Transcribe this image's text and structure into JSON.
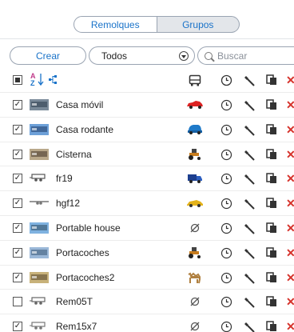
{
  "tabs": {
    "remolques": "Remolques",
    "grupos": "Grupos"
  },
  "toolbar": {
    "crear_label": "Crear",
    "filter_value": "Todos",
    "search_placeholder": "Buscar"
  },
  "header": {
    "sort_label": "A Z"
  },
  "rows": [
    {
      "name": "Casa móvil",
      "checked": true,
      "vehicle": "car-red-icon"
    },
    {
      "name": "Casa rodante",
      "checked": true,
      "vehicle": "car-blue-icon"
    },
    {
      "name": "Cisterna",
      "checked": true,
      "vehicle": "tractor-icon"
    },
    {
      "name": "fr19",
      "checked": true,
      "vehicle": "truck-blue-icon"
    },
    {
      "name": "hgf12",
      "checked": true,
      "vehicle": "car-yellow-icon"
    },
    {
      "name": "Portable house",
      "checked": true,
      "vehicle": "none-icon"
    },
    {
      "name": "Portacoches",
      "checked": true,
      "vehicle": "tractor-icon"
    },
    {
      "name": "Portacoches2",
      "checked": true,
      "vehicle": "camel-icon"
    },
    {
      "name": "Rem05T",
      "checked": false,
      "vehicle": "none-icon"
    },
    {
      "name": "Rem15x7",
      "checked": true,
      "vehicle": "none-icon"
    }
  ],
  "colors": {
    "accent": "#1a73c9",
    "delete": "#d6322b",
    "tab_active_bg": "#e3e6ea"
  }
}
